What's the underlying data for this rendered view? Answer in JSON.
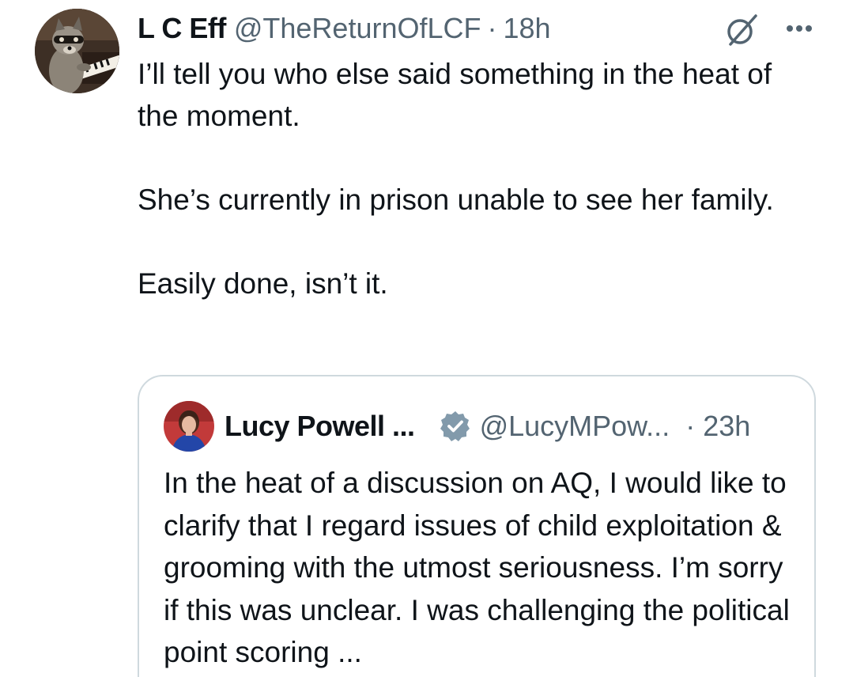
{
  "tweet": {
    "display_name": "L C Eff",
    "handle": "@TheReturnOfLCF",
    "separator": "·",
    "time": "18h",
    "avatar_icon": "raccoon-piano-avatar",
    "grok_icon": "grok-icon",
    "more_icon": "more-options-icon",
    "paragraphs": [
      "I’ll tell you who else said something in the heat of the moment.",
      "She’s currently in prison unable to see her family.",
      "Easily done, isn’t it."
    ]
  },
  "quoted_tweet": {
    "display_name": "Lucy Powell ...",
    "handle": "@LucyMPow...",
    "separator": "·",
    "time": "23h",
    "verified_icon": "verified-badge-icon",
    "avatar_icon": "profile-photo-avatar",
    "text": "In the heat of a discussion on AQ, I would like to clarify that I regard issues of child exploitation & grooming with the utmost seriousness. I’m sorry if this was unclear. I was challenging the political point scoring ..."
  },
  "colors": {
    "text_primary": "#0f1419",
    "text_secondary": "#536471",
    "border": "#cfd9de",
    "verified_badge": "#829aab"
  }
}
